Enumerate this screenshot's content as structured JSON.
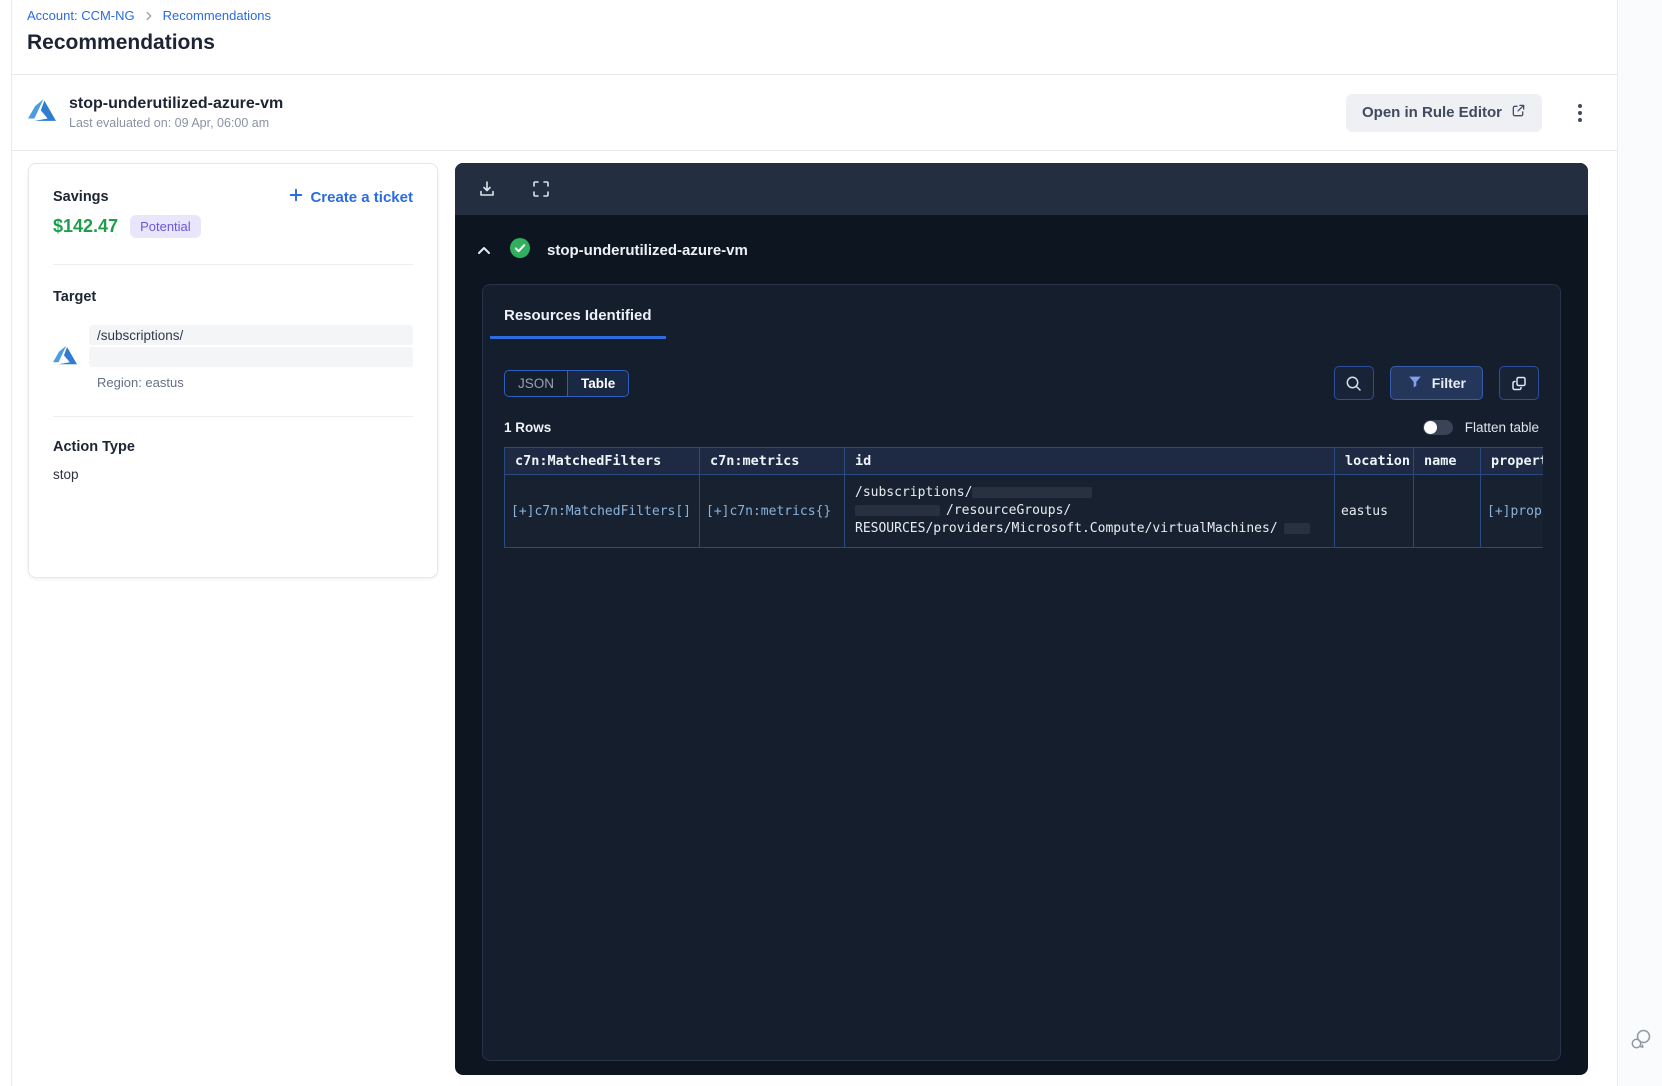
{
  "breadcrumb": {
    "account_link": "Account: CCM-NG",
    "current": "Recommendations"
  },
  "page": {
    "title": "Recommendations"
  },
  "rule_header": {
    "name": "stop-underutilized-azure-vm",
    "last_evaluated": "Last evaluated on: 09 Apr, 06:00 am",
    "open_in_rule_editor": "Open in Rule Editor"
  },
  "summary": {
    "savings_label": "Savings",
    "create_ticket": "Create a ticket",
    "amount": "$142.47",
    "badge": "Potential",
    "target_label": "Target",
    "target_path": "/subscriptions/",
    "target_region": "Region: eastus",
    "action_label": "Action Type",
    "action_value": "stop"
  },
  "viewer": {
    "rule_name": "stop-underutilized-azure-vm",
    "tab_resources": "Resources Identified",
    "view_json": "JSON",
    "view_table": "Table",
    "filter": "Filter",
    "rows_count": "1 Rows",
    "flatten_label": "Flatten table",
    "table": {
      "headers": [
        "c7n:MatchedFilters",
        "c7n:metrics",
        "id",
        "location",
        "name",
        "propert"
      ],
      "row": {
        "matched_filters": "[+]c7n:MatchedFilters[]",
        "metrics": "[+]c7n:metrics{}",
        "id_line1": "/subscriptions/",
        "id_line2": "/resourceGroups/",
        "id_line3": "RESOURCES/providers/Microsoft.Compute/virtualMachines/",
        "location": "eastus",
        "name": "",
        "properties": "[+]prop"
      }
    }
  },
  "colors": {
    "link_blue": "#2b6be4",
    "accent_blue": "#2e6be0",
    "savings_green": "#1e9e4c",
    "badge_bg": "#e9e6fc",
    "badge_text": "#6a58d8",
    "panel_bg": "#0d1521",
    "success_green": "#2fb05e"
  }
}
